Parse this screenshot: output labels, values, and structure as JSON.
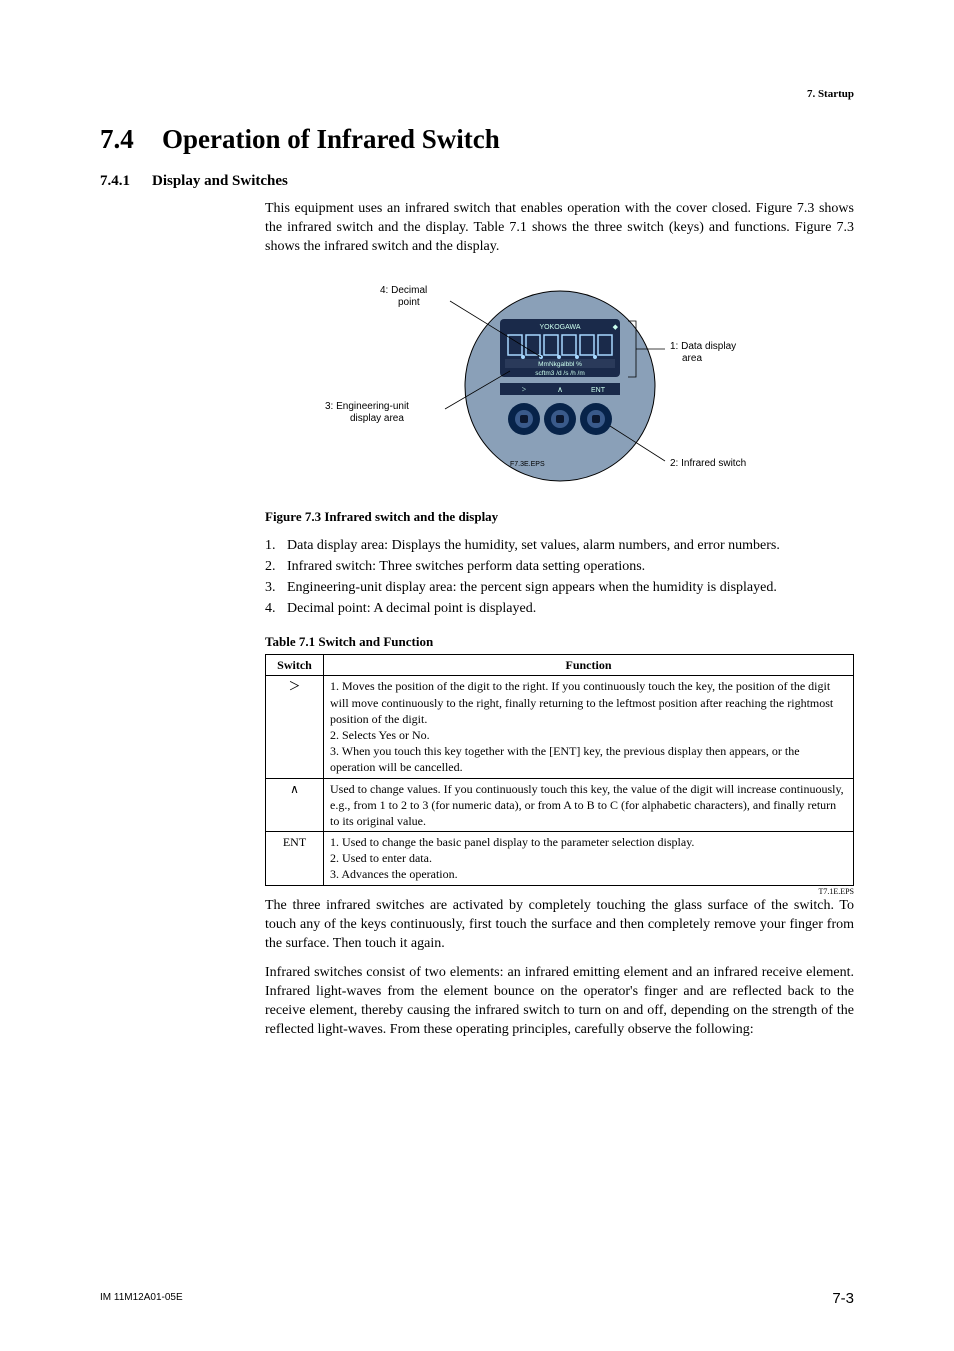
{
  "running_head": "7.  Startup",
  "section": {
    "number": "7.4",
    "title": "Operation of Infrared Switch"
  },
  "subsection": {
    "number": "7.4.1",
    "title": "Display and Switches"
  },
  "intro": "This equipment uses an infrared switch that enables operation with the cover closed. Figure 7.3 shows the infrared switch and the display. Table 7.1 shows the three switch (keys) and functions. Figure 7.3 shows the infrared switch and the display.",
  "figure": {
    "labels": {
      "decimal": "4: Decimal\npoint",
      "engineering": "3: Engineering-unit\ndisplay area",
      "data_area": "1: Data display\narea",
      "infrared": "2: Infrared switch",
      "brand": "YOKOGAWA",
      "unit_line1": "MmNkgalbbl  %",
      "unit_line2": "scftm3 /d /s /h /m",
      "key_right": ">",
      "key_up": "∧",
      "key_ent": "ENT",
      "eps": "F7.3E.EPS"
    },
    "caption": "Figure 7.3 Infrared switch and the display"
  },
  "numbered_list": [
    "Data display area: Displays the humidity, set values, alarm numbers, and error numbers.",
    "Infrared switch: Three switches perform data setting operations.",
    "Engineering-unit display area: the percent sign appears when the humidity is displayed.",
    "Decimal point: A decimal point is displayed."
  ],
  "table": {
    "caption": "Table 7.1   Switch and Function",
    "headers": [
      "Switch",
      "Function"
    ],
    "rows": [
      {
        "switch": "＞",
        "function": "1. Moves the position of the digit to the right. If you continuously touch the key, the position of the digit will move continuously to the right, finally returning to the leftmost position after reaching the rightmost position of the digit.\n2. Selects Yes or No.\n3. When you touch this key together with the [ENT] key, the previous display then appears, or the operation will be cancelled."
      },
      {
        "switch": "∧",
        "function": "Used to change values. If you continuously touch this key, the value of the digit will increase continuously, e.g., from 1 to 2 to 3 (for numeric data), or from A to B to C (for alphabetic characters), and finally return to its original value."
      },
      {
        "switch": "ENT",
        "function": "1. Used to change the basic panel display to the parameter selection display.\n2. Used to enter data.\n3. Advances the operation."
      }
    ],
    "eps": "T7.1E.EPS"
  },
  "para_after_table": "The three infrared switches are activated by completely touching the glass surface of the switch. To touch any of the keys continuously, first touch the surface and then completely remove your finger from the surface. Then touch it again.",
  "para_infrared": "Infrared switches consist of two elements: an infrared emitting element and an infrared receive element. Infrared light-waves from the element bounce on the operator's finger and are reflected back to the receive element, thereby causing the infrared switch to turn on and off, depending on the strength of the reflected light-waves. From these operating principles, carefully observe the following:",
  "footer": {
    "left": "IM 11M12A01-05E",
    "right": "7-3"
  }
}
